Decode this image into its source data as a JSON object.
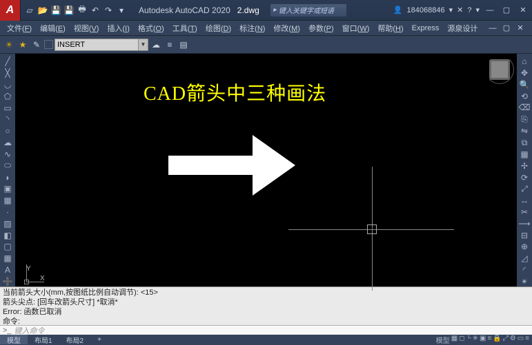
{
  "titlebar": {
    "logo": "A",
    "app": "Autodesk AutoCAD 2020",
    "doc": "2.dwg",
    "search_placeholder": "键入关键字或短语",
    "user": "184068846"
  },
  "menu": {
    "items": [
      {
        "label": "文件",
        "key": "F"
      },
      {
        "label": "编辑",
        "key": "E"
      },
      {
        "label": "视图",
        "key": "V"
      },
      {
        "label": "插入",
        "key": "I"
      },
      {
        "label": "格式",
        "key": "O"
      },
      {
        "label": "工具",
        "key": "T"
      },
      {
        "label": "绘图",
        "key": "D"
      },
      {
        "label": "标注",
        "key": "N"
      },
      {
        "label": "修改",
        "key": "M"
      },
      {
        "label": "参数",
        "key": "P"
      },
      {
        "label": "窗口",
        "key": "W"
      },
      {
        "label": "帮助",
        "key": "H"
      },
      {
        "label": "Express",
        "key": ""
      },
      {
        "label": "源泉设计",
        "key": ""
      }
    ]
  },
  "toolbar": {
    "insert_value": "INSERT"
  },
  "canvas": {
    "heading": "CAD箭头中三种画法",
    "ucs_x": "X",
    "ucs_y": "Y"
  },
  "command": {
    "line1": "当前箭头大小(mm,按图纸比例自动调节): <15>",
    "line2": "箭头尖点: [回车改箭头尺寸] *取消*",
    "line3": "Error: 函数已取消",
    "line4": "命令:",
    "prompt": ">_",
    "hint": "键入命令"
  },
  "tabs": {
    "model": "模型",
    "layout1": "布局1",
    "layout2": "布局2"
  },
  "status": {
    "model_label": "模型"
  }
}
